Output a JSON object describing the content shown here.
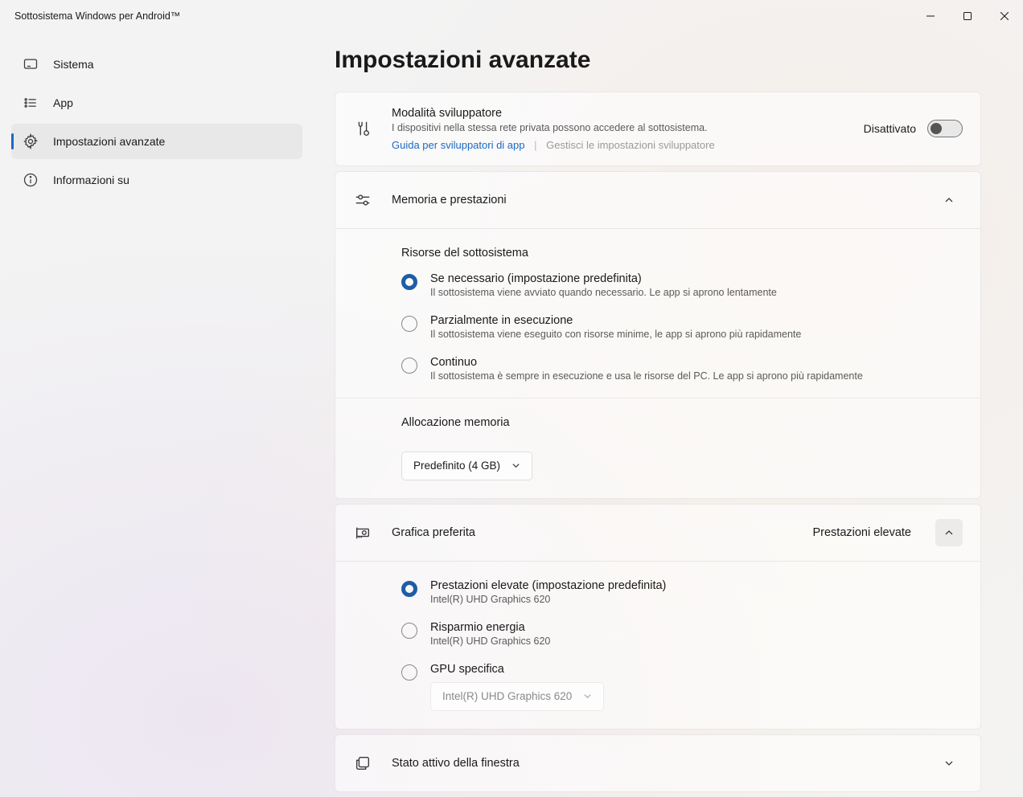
{
  "window": {
    "title": "Sottosistema Windows per Android™"
  },
  "sidebar": {
    "items": [
      {
        "label": "Sistema"
      },
      {
        "label": "App"
      },
      {
        "label": "Impostazioni avanzate"
      },
      {
        "label": "Informazioni su"
      }
    ]
  },
  "page": {
    "title": "Impostazioni avanzate"
  },
  "devmode": {
    "title": "Modalità sviluppatore",
    "desc": "I dispositivi nella stessa rete privata possono accedere al sottosistema.",
    "link_guide": "Guida per sviluppatori di app",
    "link_manage": "Gestisci le impostazioni sviluppatore",
    "toggle_state": "Disattivato"
  },
  "memory": {
    "title": "Memoria e prestazioni",
    "resources_title": "Risorse del sottosistema",
    "options": [
      {
        "label": "Se necessario (impostazione predefinita)",
        "desc": "Il sottosistema viene avviato quando necessario. Le app si aprono lentamente"
      },
      {
        "label": "Parzialmente in esecuzione",
        "desc": "Il sottosistema viene eseguito con risorse minime, le app si aprono più rapidamente"
      },
      {
        "label": "Continuo",
        "desc": "Il sottosistema è sempre in esecuzione e usa le risorse del PC. Le app si aprono più rapidamente"
      }
    ],
    "allocation_title": "Allocazione memoria",
    "allocation_value": "Predefinito (4 GB)"
  },
  "graphics": {
    "title": "Grafica preferita",
    "current": "Prestazioni elevate",
    "options": [
      {
        "label": "Prestazioni elevate (impostazione predefinita)",
        "desc": "Intel(R) UHD Graphics 620"
      },
      {
        "label": "Risparmio energia",
        "desc": "Intel(R) UHD Graphics 620"
      },
      {
        "label": "GPU specifica",
        "dropdown": "Intel(R) UHD Graphics 620"
      }
    ]
  },
  "activewindow": {
    "title": "Stato attivo della finestra"
  }
}
